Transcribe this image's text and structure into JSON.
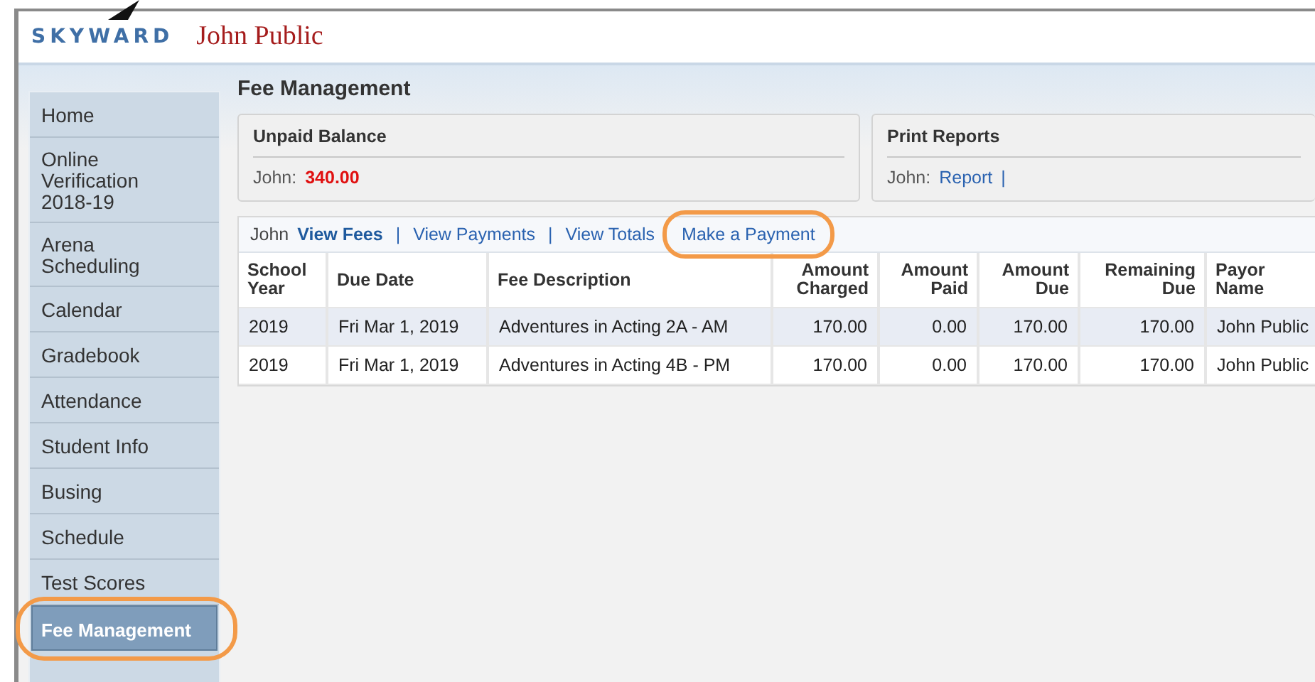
{
  "header": {
    "logo": "SKYWARD",
    "user": "John Public"
  },
  "sidebar": {
    "items": [
      {
        "label": "Home",
        "selected": false,
        "highlighted": false
      },
      {
        "label": "Online Verification 2018-19",
        "selected": false,
        "highlighted": false
      },
      {
        "label": "Arena Scheduling",
        "selected": false,
        "highlighted": false
      },
      {
        "label": "Calendar",
        "selected": false,
        "highlighted": false
      },
      {
        "label": "Gradebook",
        "selected": false,
        "highlighted": false
      },
      {
        "label": "Attendance",
        "selected": false,
        "highlighted": false
      },
      {
        "label": "Student Info",
        "selected": false,
        "highlighted": false
      },
      {
        "label": "Busing",
        "selected": false,
        "highlighted": false
      },
      {
        "label": "Schedule",
        "selected": false,
        "highlighted": false
      },
      {
        "label": "Test Scores",
        "selected": false,
        "highlighted": false
      },
      {
        "label": "Fee Management",
        "selected": true,
        "highlighted": true
      }
    ]
  },
  "page_title": "Fee Management",
  "unpaid_balance": {
    "title": "Unpaid Balance",
    "student": "John:",
    "amount": "340.00"
  },
  "print_reports": {
    "title": "Print Reports",
    "student": "John:",
    "link": "Report",
    "separator": "|"
  },
  "fee_tabs": {
    "student": "John",
    "items": [
      {
        "label": "View Fees",
        "selected": true,
        "highlighted": false
      },
      {
        "label": "View Payments",
        "selected": false,
        "highlighted": false
      },
      {
        "label": "View Totals",
        "selected": false,
        "highlighted": false
      },
      {
        "label": "Make a Payment",
        "selected": false,
        "highlighted": true
      }
    ],
    "separator": "|"
  },
  "table": {
    "columns": [
      {
        "label": "School Year",
        "kind": "text"
      },
      {
        "label": "Due Date",
        "kind": "text"
      },
      {
        "label": "Fee Description",
        "kind": "text"
      },
      {
        "label": "Amount Charged",
        "kind": "amount"
      },
      {
        "label": "Amount Paid",
        "kind": "amount"
      },
      {
        "label": "Amount Due",
        "kind": "amount"
      },
      {
        "label": "Remaining Due",
        "kind": "amount"
      },
      {
        "label": "Payor Name",
        "kind": "text"
      }
    ],
    "rows": [
      [
        "2019",
        "Fri Mar 1, 2019",
        "Adventures in Acting 2A - AM",
        "170.00",
        "0.00",
        "170.00",
        "170.00",
        "John Public"
      ],
      [
        "2019",
        "Fri Mar 1, 2019",
        "Adventures in Acting 4B - PM",
        "170.00",
        "0.00",
        "170.00",
        "170.00",
        "John Public"
      ]
    ]
  }
}
